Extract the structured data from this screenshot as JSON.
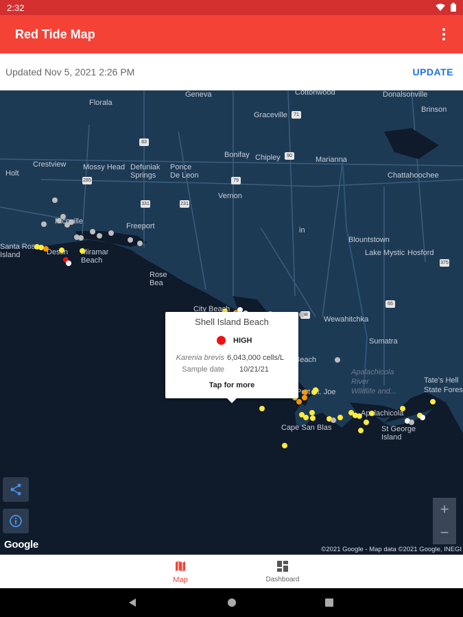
{
  "status_bar": {
    "time": "2:32"
  },
  "app_bar": {
    "title": "Red Tide Map",
    "menu_icon": "more-vert-icon"
  },
  "update_row": {
    "updated_text": "Updated Nov 5, 2021 2:26 PM",
    "update_label": "UPDATE"
  },
  "map": {
    "labels": {
      "geneva": "Geneva",
      "cottonwood": "Cottonwood",
      "donalsonville": "Donalsonville",
      "florala": "Florala",
      "graceville": "Graceville",
      "brinson": "Brinson",
      "crestview": "Crestview",
      "mossy_head": "Mossy Head",
      "defuniak": "Defuniak\nSprings",
      "ponce": "Ponce\nDe Leon",
      "bonifay": "Bonifay",
      "chipley": "Chipley",
      "marianna": "Marianna",
      "chattahoochee": "Chattahoochee",
      "holt": "Holt",
      "vernon": "Vernon",
      "niceville": "Niceville",
      "freeport": "Freeport",
      "santa_rosa": "Santa Rosa\nIsland",
      "destin": "Destin",
      "miramar": "Miramar\nBeach",
      "rosemary": "Rose\nBea",
      "blountstown": "Blountstown",
      "lake_mystic": "Lake Mystic",
      "hosford": "Hosford",
      "city_beach": "City Beach",
      "wewahitchka": "Wewahitchka",
      "sumatra": "Sumatra",
      "mexico_beach": "Mexico Beach",
      "apalachicola_river": "Apalachicola\nRiver\nWildlife and...",
      "tates_hell": "Tate's Hell\nState Forest",
      "port_st_joe": "Port St. Joe",
      "apalachicola": "Apalachicola",
      "cape_san_blas": "Cape San Blas",
      "st_george": "St George\nIsland",
      "in_partial": "in"
    },
    "shields": [
      "83",
      "285",
      "331",
      "231",
      "79",
      "71",
      "90",
      "65",
      "375",
      "98"
    ],
    "popup": {
      "title": "Shell Island Beach",
      "level": "HIGH",
      "level_color": "#ee1111",
      "organism_label": "Karenia brevis",
      "organism_value": "6,043,000 cells/L",
      "date_label": "Sample date",
      "date_value": "10/21/21",
      "tap_text": "Tap for more"
    },
    "share_icon": "share-icon",
    "info_icon": "info-icon",
    "zoom_in_label": "+",
    "zoom_out_label": "−",
    "google_logo": "Google",
    "attribution": "©2021 Google - Map data ©2021 Google, INEGI",
    "colors": {
      "high": "#ee1111",
      "medium": "#ff9800",
      "low": "#ffeb3b",
      "none": "#bdbdbd",
      "very_low": "#ffffff"
    }
  },
  "bottom_nav": {
    "map_label": "Map",
    "map_icon": "map-icon",
    "dashboard_label": "Dashboard",
    "dashboard_icon": "dashboard-icon",
    "active_color": "#f44336"
  },
  "system_nav": {
    "back_icon": "back-icon",
    "home_icon": "home-icon",
    "recents_icon": "recents-icon"
  }
}
